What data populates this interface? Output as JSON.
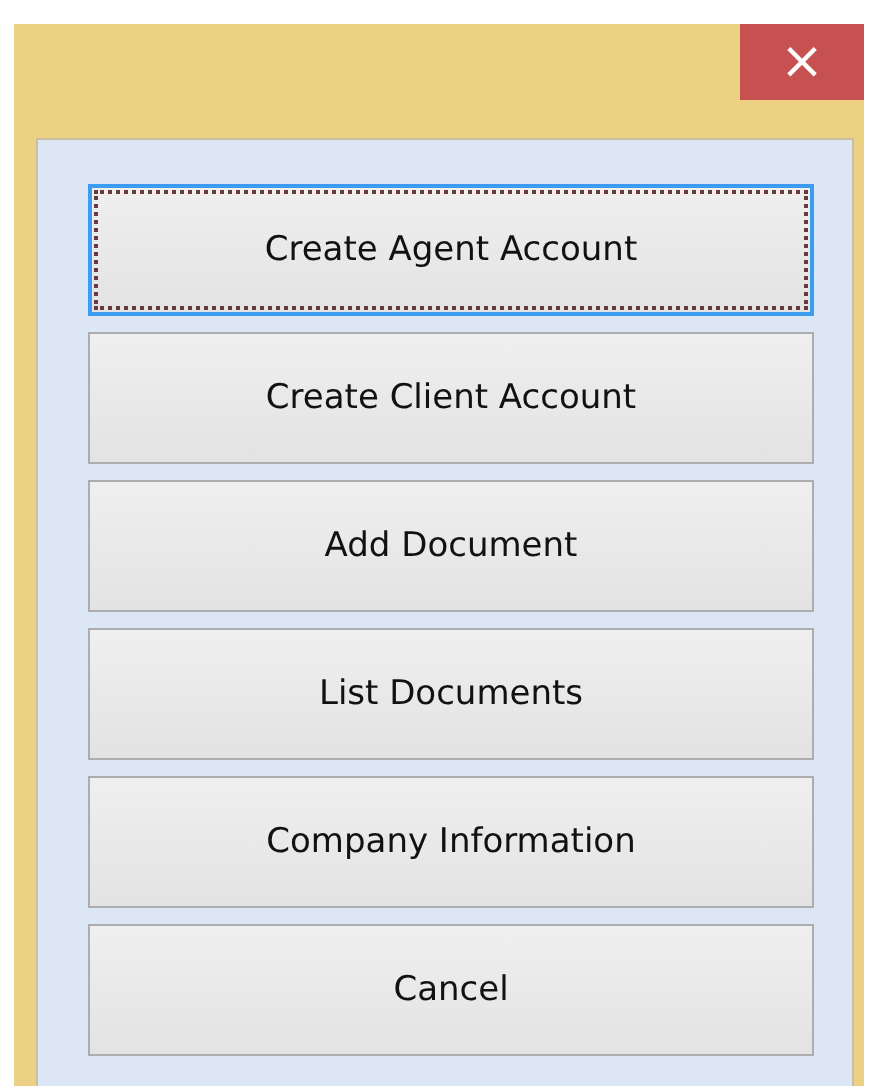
{
  "window": {
    "close_button": "×"
  },
  "buttons": [
    {
      "label": "Create Agent Account",
      "focused": true
    },
    {
      "label": "Create Client Account",
      "focused": false
    },
    {
      "label": "Add Document",
      "focused": false
    },
    {
      "label": "List Documents",
      "focused": false
    },
    {
      "label": "Company Information",
      "focused": false
    },
    {
      "label": "Cancel",
      "focused": false
    }
  ]
}
